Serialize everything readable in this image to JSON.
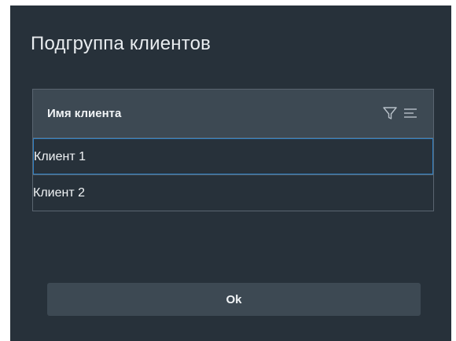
{
  "dialog": {
    "title": "Подгруппа клиентов"
  },
  "grid": {
    "column_header": "Имя клиента",
    "header_icons": [
      "filter-icon",
      "sort-lines-icon"
    ],
    "rows": [
      {
        "name": "Клиент 1",
        "selected": true
      },
      {
        "name": "Клиент 2",
        "selected": false
      }
    ]
  },
  "footer": {
    "ok_label": "Ok"
  },
  "colors": {
    "dialog_background": "#27313a",
    "header_background": "#3d4953",
    "selection_border": "#2f80c4",
    "button_background": "#3d4953"
  }
}
